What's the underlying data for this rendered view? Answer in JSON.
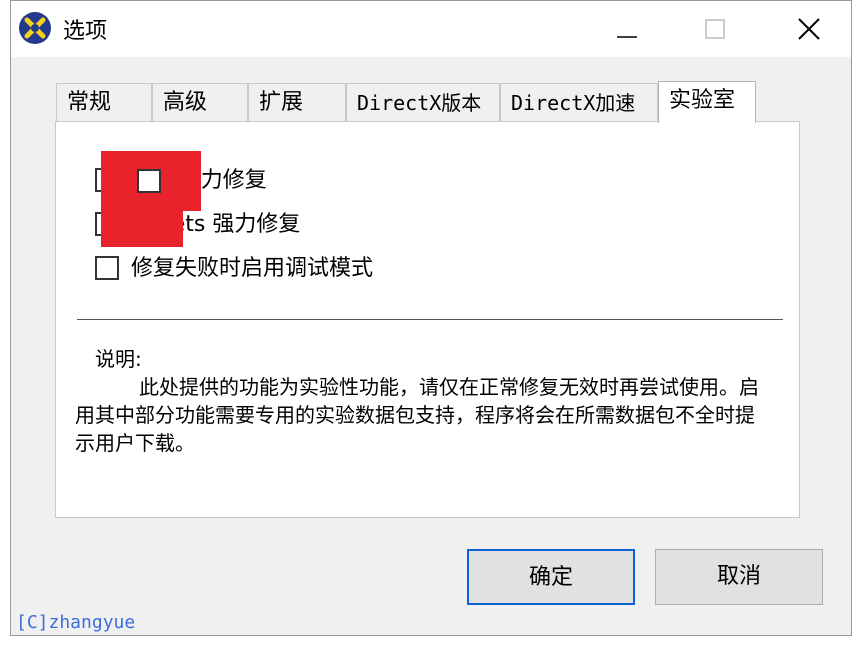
{
  "window": {
    "title": "选项"
  },
  "tabs": [
    {
      "label": "常规"
    },
    {
      "label": "高级"
    },
    {
      "label": "扩展"
    },
    {
      "label": "DirectX版本"
    },
    {
      "label": "DirectX加速"
    },
    {
      "label": "实验室"
    }
  ],
  "options": [
    {
      "label": "C + 强力修复",
      "checked": false
    },
    {
      "label": "PI Sets 强力修复",
      "checked": false
    },
    {
      "label": "修复失败时启用调试模式",
      "checked": false
    }
  ],
  "description": {
    "title": "说明:",
    "body": "此处提供的功能为实验性功能，请仅在正常修复无效时再尝试使用。启用其中部分功能需要专用的实验数据包支持，程序将会在所需数据包不全时提示用户下载。"
  },
  "buttons": {
    "ok": "确定",
    "cancel": "取消"
  },
  "watermark": "[C]zhangyue",
  "colors": {
    "redaction": "#e8232b",
    "primary_border": "#0a64d6",
    "watermark": "#3a6fd8"
  }
}
